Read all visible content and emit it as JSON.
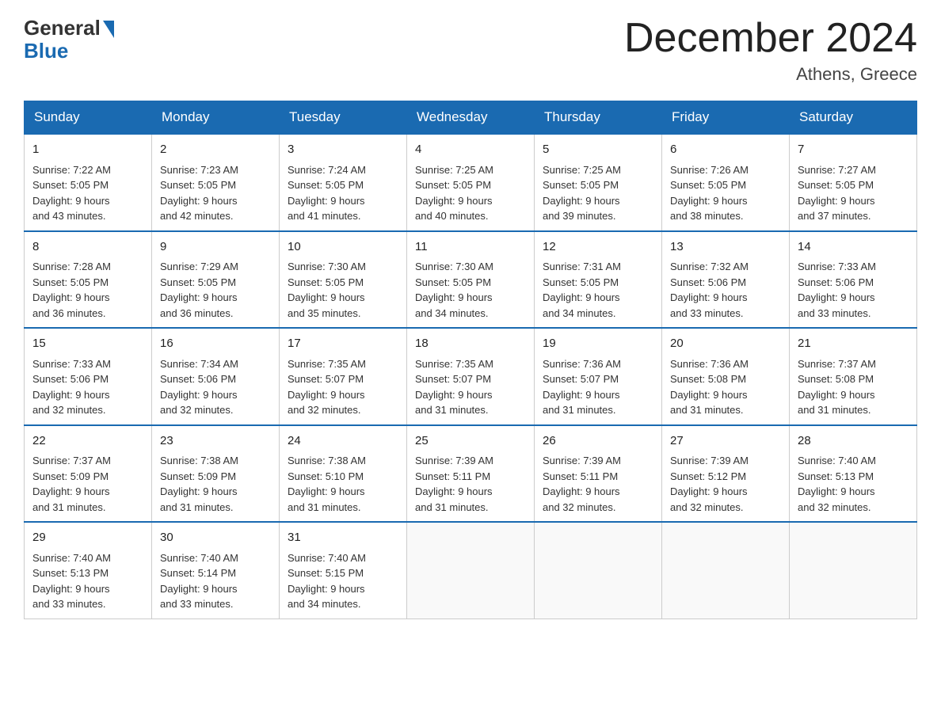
{
  "header": {
    "logo_general": "General",
    "logo_blue": "Blue",
    "month_title": "December 2024",
    "location": "Athens, Greece"
  },
  "days_of_week": [
    "Sunday",
    "Monday",
    "Tuesday",
    "Wednesday",
    "Thursday",
    "Friday",
    "Saturday"
  ],
  "weeks": [
    [
      {
        "day": "1",
        "sunrise": "7:22 AM",
        "sunset": "5:05 PM",
        "daylight": "9 hours and 43 minutes."
      },
      {
        "day": "2",
        "sunrise": "7:23 AM",
        "sunset": "5:05 PM",
        "daylight": "9 hours and 42 minutes."
      },
      {
        "day": "3",
        "sunrise": "7:24 AM",
        "sunset": "5:05 PM",
        "daylight": "9 hours and 41 minutes."
      },
      {
        "day": "4",
        "sunrise": "7:25 AM",
        "sunset": "5:05 PM",
        "daylight": "9 hours and 40 minutes."
      },
      {
        "day": "5",
        "sunrise": "7:25 AM",
        "sunset": "5:05 PM",
        "daylight": "9 hours and 39 minutes."
      },
      {
        "day": "6",
        "sunrise": "7:26 AM",
        "sunset": "5:05 PM",
        "daylight": "9 hours and 38 minutes."
      },
      {
        "day": "7",
        "sunrise": "7:27 AM",
        "sunset": "5:05 PM",
        "daylight": "9 hours and 37 minutes."
      }
    ],
    [
      {
        "day": "8",
        "sunrise": "7:28 AM",
        "sunset": "5:05 PM",
        "daylight": "9 hours and 36 minutes."
      },
      {
        "day": "9",
        "sunrise": "7:29 AM",
        "sunset": "5:05 PM",
        "daylight": "9 hours and 36 minutes."
      },
      {
        "day": "10",
        "sunrise": "7:30 AM",
        "sunset": "5:05 PM",
        "daylight": "9 hours and 35 minutes."
      },
      {
        "day": "11",
        "sunrise": "7:30 AM",
        "sunset": "5:05 PM",
        "daylight": "9 hours and 34 minutes."
      },
      {
        "day": "12",
        "sunrise": "7:31 AM",
        "sunset": "5:05 PM",
        "daylight": "9 hours and 34 minutes."
      },
      {
        "day": "13",
        "sunrise": "7:32 AM",
        "sunset": "5:06 PM",
        "daylight": "9 hours and 33 minutes."
      },
      {
        "day": "14",
        "sunrise": "7:33 AM",
        "sunset": "5:06 PM",
        "daylight": "9 hours and 33 minutes."
      }
    ],
    [
      {
        "day": "15",
        "sunrise": "7:33 AM",
        "sunset": "5:06 PM",
        "daylight": "9 hours and 32 minutes."
      },
      {
        "day": "16",
        "sunrise": "7:34 AM",
        "sunset": "5:06 PM",
        "daylight": "9 hours and 32 minutes."
      },
      {
        "day": "17",
        "sunrise": "7:35 AM",
        "sunset": "5:07 PM",
        "daylight": "9 hours and 32 minutes."
      },
      {
        "day": "18",
        "sunrise": "7:35 AM",
        "sunset": "5:07 PM",
        "daylight": "9 hours and 31 minutes."
      },
      {
        "day": "19",
        "sunrise": "7:36 AM",
        "sunset": "5:07 PM",
        "daylight": "9 hours and 31 minutes."
      },
      {
        "day": "20",
        "sunrise": "7:36 AM",
        "sunset": "5:08 PM",
        "daylight": "9 hours and 31 minutes."
      },
      {
        "day": "21",
        "sunrise": "7:37 AM",
        "sunset": "5:08 PM",
        "daylight": "9 hours and 31 minutes."
      }
    ],
    [
      {
        "day": "22",
        "sunrise": "7:37 AM",
        "sunset": "5:09 PM",
        "daylight": "9 hours and 31 minutes."
      },
      {
        "day": "23",
        "sunrise": "7:38 AM",
        "sunset": "5:09 PM",
        "daylight": "9 hours and 31 minutes."
      },
      {
        "day": "24",
        "sunrise": "7:38 AM",
        "sunset": "5:10 PM",
        "daylight": "9 hours and 31 minutes."
      },
      {
        "day": "25",
        "sunrise": "7:39 AM",
        "sunset": "5:11 PM",
        "daylight": "9 hours and 31 minutes."
      },
      {
        "day": "26",
        "sunrise": "7:39 AM",
        "sunset": "5:11 PM",
        "daylight": "9 hours and 32 minutes."
      },
      {
        "day": "27",
        "sunrise": "7:39 AM",
        "sunset": "5:12 PM",
        "daylight": "9 hours and 32 minutes."
      },
      {
        "day": "28",
        "sunrise": "7:40 AM",
        "sunset": "5:13 PM",
        "daylight": "9 hours and 32 minutes."
      }
    ],
    [
      {
        "day": "29",
        "sunrise": "7:40 AM",
        "sunset": "5:13 PM",
        "daylight": "9 hours and 33 minutes."
      },
      {
        "day": "30",
        "sunrise": "7:40 AM",
        "sunset": "5:14 PM",
        "daylight": "9 hours and 33 minutes."
      },
      {
        "day": "31",
        "sunrise": "7:40 AM",
        "sunset": "5:15 PM",
        "daylight": "9 hours and 34 minutes."
      },
      null,
      null,
      null,
      null
    ]
  ],
  "labels": {
    "sunrise": "Sunrise:",
    "sunset": "Sunset:",
    "daylight": "Daylight:"
  }
}
